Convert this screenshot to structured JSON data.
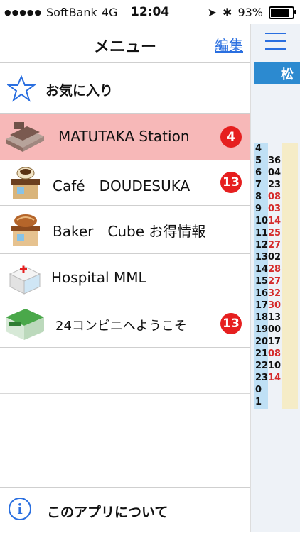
{
  "status_bar": {
    "signal": "●●●●●",
    "carrier": "SoftBank",
    "network": "4G",
    "time": "12:04",
    "battery_percent": "93%",
    "battery_level": 0.93
  },
  "header": {
    "title": "メニュー",
    "edit_label": "編集"
  },
  "favorites": {
    "label": "お気に入り"
  },
  "items": [
    {
      "label": "MATUTAKA Station",
      "badge": "4"
    },
    {
      "label": "Café　DOUDESUKA",
      "badge": "13"
    },
    {
      "label": "Baker　Cube お得情報",
      "badge": ""
    },
    {
      "label": "Hospital MML",
      "badge": ""
    },
    {
      "label": "24コンビニへようこそ",
      "badge": "13"
    }
  ],
  "footer": {
    "label": "このアプリについて",
    "icon": "info-icon"
  },
  "colors": {
    "accent": "#2a6fe0",
    "selected_row": "#f7b8b8",
    "badge": "#e61f1f"
  },
  "timetable_peek": {
    "header": "松",
    "rows": [
      {
        "hour": "4",
        "min": ""
      },
      {
        "hour": "5",
        "min": "36"
      },
      {
        "hour": "6",
        "min": "04"
      },
      {
        "hour": "7",
        "min": "23"
      },
      {
        "hour": "8",
        "min": "08"
      },
      {
        "hour": "9",
        "min": "03"
      },
      {
        "hour": "10",
        "min": "14"
      },
      {
        "hour": "11",
        "min": "25"
      },
      {
        "hour": "12",
        "min": "27"
      },
      {
        "hour": "13",
        "min": "02"
      },
      {
        "hour": "14",
        "min": "28"
      },
      {
        "hour": "15",
        "min": "27"
      },
      {
        "hour": "16",
        "min": "32"
      },
      {
        "hour": "17",
        "min": "30"
      },
      {
        "hour": "18",
        "min": "13"
      },
      {
        "hour": "19",
        "min": "00"
      },
      {
        "hour": "20",
        "min": "17"
      },
      {
        "hour": "21",
        "min": "08"
      },
      {
        "hour": "22",
        "min": "10"
      },
      {
        "hour": "23",
        "min": "14"
      },
      {
        "hour": "0",
        "min": ""
      },
      {
        "hour": "1",
        "min": ""
      }
    ]
  }
}
